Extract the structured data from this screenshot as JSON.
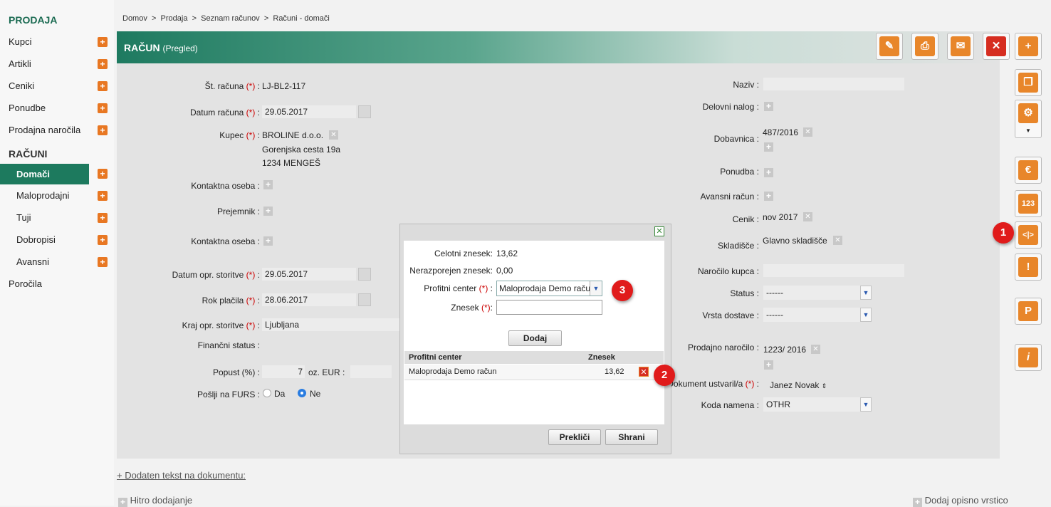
{
  "breadcrumb": {
    "items": [
      "Domov",
      ">",
      "Prodaja",
      ">",
      "Seznam računov",
      ">",
      "Računi - domači"
    ]
  },
  "sidebar": {
    "section1": "PRODAJA",
    "items1": [
      {
        "label": "Kupci"
      },
      {
        "label": "Artikli"
      },
      {
        "label": "Ceniki"
      },
      {
        "label": "Ponudbe"
      },
      {
        "label": "Prodajna naročila"
      }
    ],
    "section2": "RAČUNI",
    "items2": [
      {
        "label": "Domači"
      },
      {
        "label": "Maloprodajni"
      },
      {
        "label": "Tuji"
      },
      {
        "label": "Dobropisi"
      },
      {
        "label": "Avansni"
      }
    ],
    "reports": "Poročila",
    "plus_glyph": "+"
  },
  "header": {
    "title": "RAČUN",
    "mode": "(Pregled)"
  },
  "form_left": {
    "st_racuna_label": "Št. računa",
    "st_racuna": "LJ-BL2-117",
    "datum_label": "Datum računa",
    "datum": "29.05.2017",
    "kupec_label": "Kupec",
    "kupec_name": "BROLINE d.o.o.",
    "kupec_addr1": "Gorenjska cesta 19a",
    "kupec_addr2": "1234 MENGEŠ",
    "kontakt_label": "Kontaktna oseba :",
    "prejemnik_label": "Prejemnik :",
    "kontakt2_label": "Kontaktna oseba :",
    "datum_opr_label": "Datum opr. storitve",
    "datum_opr": "29.05.2017",
    "rok_label": "Rok plačila",
    "rok": "28.06.2017",
    "kraj_label": "Kraj opr. storitve",
    "kraj": "Ljubljana",
    "fin_label": "Finančni status :",
    "popust_label": "Popust (%) :",
    "popust": "7",
    "oz_label": "oz. EUR :",
    "furs_label": "Pošlji na FURS :",
    "da": "Da",
    "ne": "Ne",
    "req": "(*)"
  },
  "form_right": {
    "naziv_label": "Naziv :",
    "delovni_label": "Delovni nalog :",
    "dobavnica_label": "Dobavnica :",
    "dobavnica": "487/2016",
    "ponudba_label": "Ponudba :",
    "avansni_label": "Avansni račun :",
    "cenik_label": "Cenik :",
    "cenik": "nov 2017",
    "skladisce_label": "Skladišče :",
    "skladisce": "Glavno skladišče",
    "narocilo_label": "Naročilo kupca :",
    "status_label": "Status :",
    "status": "------",
    "dostava_label": "Vrsta dostave :",
    "dostava": "------",
    "prod_narocilo_label": "Prodajno naročilo :",
    "prod_narocilo": "1223/ 2016",
    "ustvaril_label": "Dokument ustvaril/a",
    "ustvaril": "Janez Novak",
    "koda_label": "Koda namena :",
    "koda": "OTHR"
  },
  "modal": {
    "celotni_label": "Celotni znesek:",
    "celotni": "13,62",
    "neraz_label": "Nerazporejen znesek:",
    "neraz": "0,00",
    "pc_label": "Profitni center",
    "pc_value": "Maloprodaja Demo raču",
    "znesek_label": "Znesek",
    "add_btn": "Dodaj",
    "table_headers": [
      "Profitni center",
      "Znesek"
    ],
    "rows": [
      {
        "pc": "Maloprodaja Demo račun",
        "znesek": "13,62"
      }
    ],
    "cancel_btn": "Prekliči",
    "save_btn": "Shrani"
  },
  "badges": [
    "1",
    "2",
    "3"
  ],
  "footer": {
    "dodaten": "+ Dodaten tekst na dokumentu:",
    "hitro": "Hitro dodajanje",
    "opisno": "Dodaj opisno vrstico"
  },
  "colors": {
    "brand": "#1d7a5e",
    "accent": "#e8862a",
    "danger": "#d62d20"
  },
  "icons": {
    "edit": "pencil-icon",
    "print": "printer-icon",
    "mail": "mail-icon",
    "delete": "close-icon",
    "add": "plus-icon",
    "copy": "copy-icon",
    "settings": "gear-icon",
    "euro": "euro-icon",
    "numbers": "numbers-icon",
    "split": "split-icon",
    "warning": "warning-icon",
    "p": "p-icon",
    "info": "info-icon"
  }
}
